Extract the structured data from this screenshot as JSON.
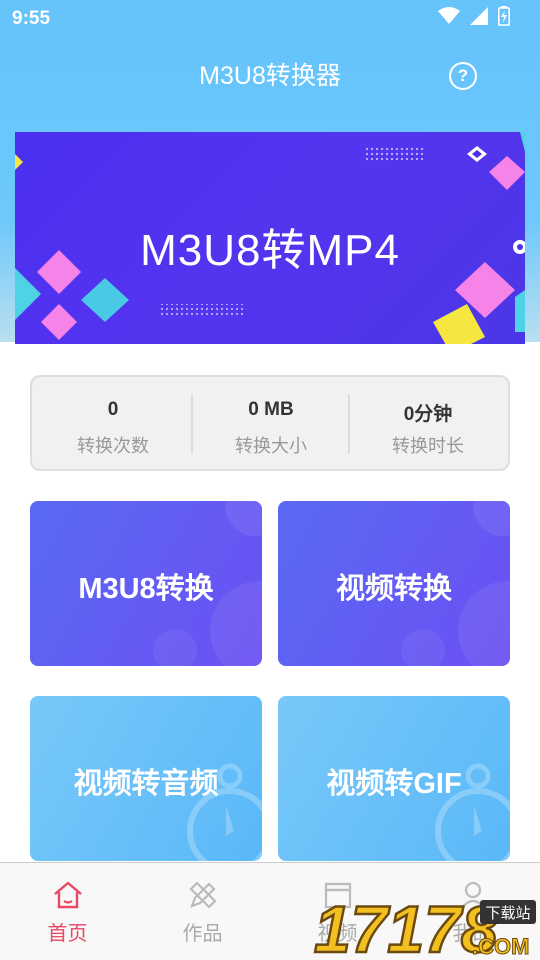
{
  "status_bar": {
    "time": "9:55"
  },
  "header": {
    "title": "M3U8转换器"
  },
  "banner": {
    "text": "M3U8转MP4"
  },
  "stats": [
    {
      "value": "0",
      "label": "转换次数"
    },
    {
      "value": "0 MB",
      "label": "转换大小"
    },
    {
      "value": "0分钟",
      "label": "转换时长"
    }
  ],
  "tiles": [
    {
      "label": "M3U8转换"
    },
    {
      "label": "视频转换"
    },
    {
      "label": "视频转音频"
    },
    {
      "label": "视频转GIF"
    }
  ],
  "bottom_nav": [
    {
      "label": "首页",
      "icon": "home-icon"
    },
    {
      "label": "作品",
      "icon": "pencil-ruler-icon"
    },
    {
      "label": "视频",
      "icon": "clapperboard-icon"
    },
    {
      "label": "我的",
      "icon": "person-icon"
    }
  ],
  "watermark": {
    "text": "17178.COM",
    "tag": "下载站"
  },
  "colors": {
    "header": "#66c4fb",
    "banner": "#4b2ff0",
    "tile_purple": "#6a4ff3",
    "tile_blue": "#5ab8f8",
    "nav_active": "#e94863",
    "nav_inactive": "#aaaaaa"
  }
}
